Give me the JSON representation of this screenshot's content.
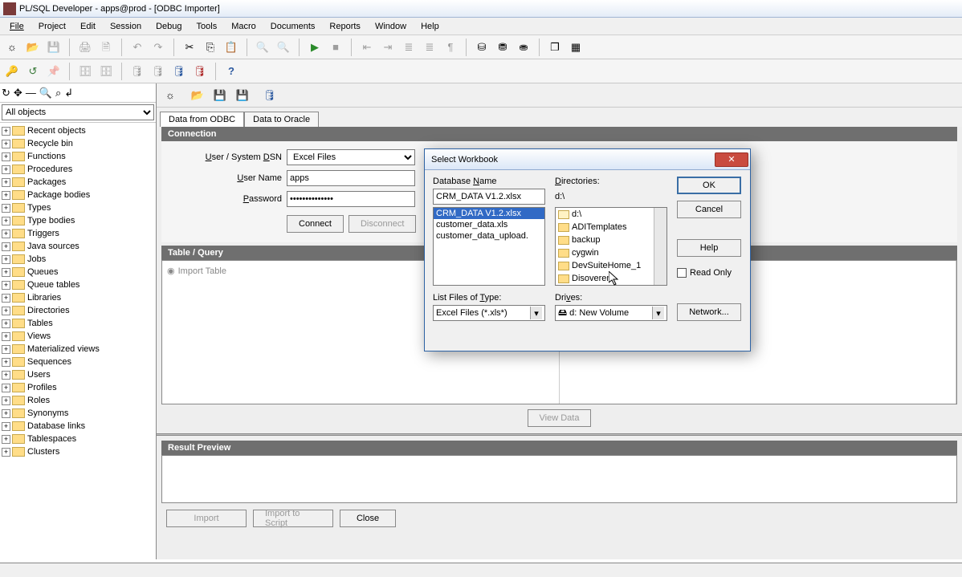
{
  "title": "PL/SQL Developer - apps@prod - [ODBC Importer]",
  "menus": [
    "File",
    "Project",
    "Edit",
    "Session",
    "Debug",
    "Tools",
    "Macro",
    "Documents",
    "Reports",
    "Window",
    "Help"
  ],
  "sidebar": {
    "selector": "All objects",
    "items": [
      "Recent objects",
      "Recycle bin",
      "Functions",
      "Procedures",
      "Packages",
      "Package bodies",
      "Types",
      "Type bodies",
      "Triggers",
      "Java sources",
      "Jobs",
      "Queues",
      "Queue tables",
      "Libraries",
      "Directories",
      "Tables",
      "Views",
      "Materialized views",
      "Sequences",
      "Users",
      "Profiles",
      "Roles",
      "Synonyms",
      "Database links",
      "Tablespaces",
      "Clusters"
    ]
  },
  "tabs": {
    "odbc": "Data from ODBC",
    "oracle": "Data to Oracle"
  },
  "sections": {
    "connection": "Connection",
    "table_query": "Table / Query",
    "result_preview": "Result Preview"
  },
  "conn": {
    "dsn_label": "User / System DSN",
    "dsn_value": "Excel Files",
    "user_label": "User Name",
    "user_value": "apps",
    "pwd_label": "Password",
    "pwd_value": "xxxxxxxxxxxxxx",
    "connect": "Connect",
    "disconnect": "Disconnect"
  },
  "table_query": {
    "import_table": "Import Table",
    "view_data": "View Data"
  },
  "bottom": {
    "import": "Import",
    "import_script": "Import to Script",
    "close": "Close"
  },
  "modal": {
    "title": "Select Workbook",
    "dbname_label": "Database Name",
    "dbname_value": "CRM_DATA V1.2.xlsx",
    "files": [
      "CRM_DATA V1.2.xlsx",
      "customer_data.xls",
      "customer_data_upload."
    ],
    "files_type_label": "List Files of Type:",
    "files_type_value": "Excel Files (*.xls*)",
    "dirs_label": "Directories:",
    "dirs_path": "d:\\",
    "dirs": [
      "d:\\",
      "ADITemplates",
      "backup",
      "cygwin",
      "DevSuiteHome_1",
      "Disoverer"
    ],
    "drives_label": "Drives:",
    "drives_value": "d: New Volume",
    "ok": "OK",
    "cancel": "Cancel",
    "help": "Help",
    "readonly": "Read Only",
    "network": "Network..."
  }
}
